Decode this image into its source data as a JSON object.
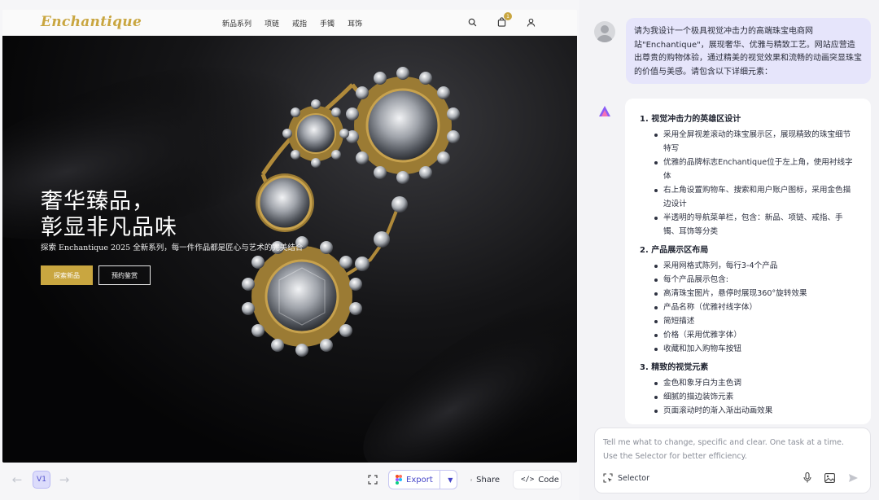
{
  "site": {
    "logo": "Enchantique",
    "menu": [
      "新品系列",
      "项链",
      "戒指",
      "手镯",
      "耳饰"
    ],
    "cart_count": "1",
    "hero_title_line1": "奢华臻品，",
    "hero_title_line2": "彰显非凡品味",
    "hero_subtitle": "探索 Enchantique 2025 全新系列，每一件作品都是匠心与艺术的完美结合",
    "primary_button": "探索新品",
    "secondary_button": "预约鉴赏",
    "accent_color": "#c9a640"
  },
  "toolbar": {
    "version_label": "V1",
    "export_label": "Export",
    "share_label": "Share",
    "code_label": "Code"
  },
  "chat": {
    "user_message": "请为我设计一个极具视觉冲击力的高端珠宝电商网站\"Enchantique\"，展现奢华、优雅与精致工艺。网站应营造出尊贵的购物体验，通过精美的视觉效果和流畅的动画突显珠宝的价值与美感。请包含以下详细元素：",
    "sections": [
      {
        "title": "1. 视觉冲击力的英雄区设计",
        "items": [
          "采用全屏视差滚动的珠宝展示区，展现精致的珠宝细节特写",
          "优雅的品牌标志Enchantique位于左上角，使用衬线字体",
          "右上角设置购物车、搜索和用户账户图标，采用金色描边设计",
          "半透明的导航菜单栏，包含：新品、项链、戒指、手镯、耳饰等分类"
        ]
      },
      {
        "title": "2. 产品展示区布局",
        "items": [
          "采用网格式陈列，每行3-4个产品",
          "每个产品展示包含:",
          "高清珠宝图片，悬停时展现360°旋转效果",
          "产品名称（优雅衬线字体）",
          "简短描述",
          "价格（采用优雅字体）",
          "收藏和加入购物车按钮"
        ]
      },
      {
        "title": "3. 精致的视觉元素",
        "items": [
          "金色和象牙白为主色调",
          "细腻的描边装饰元素",
          "页面滚动时的渐入渐出动画效果"
        ]
      }
    ],
    "input_placeholder_line1": "Tell me what to change, specific and clear. One task at a time.",
    "input_placeholder_line2": "Use the Selector for better efficiency.",
    "selector_label": "Selector"
  }
}
